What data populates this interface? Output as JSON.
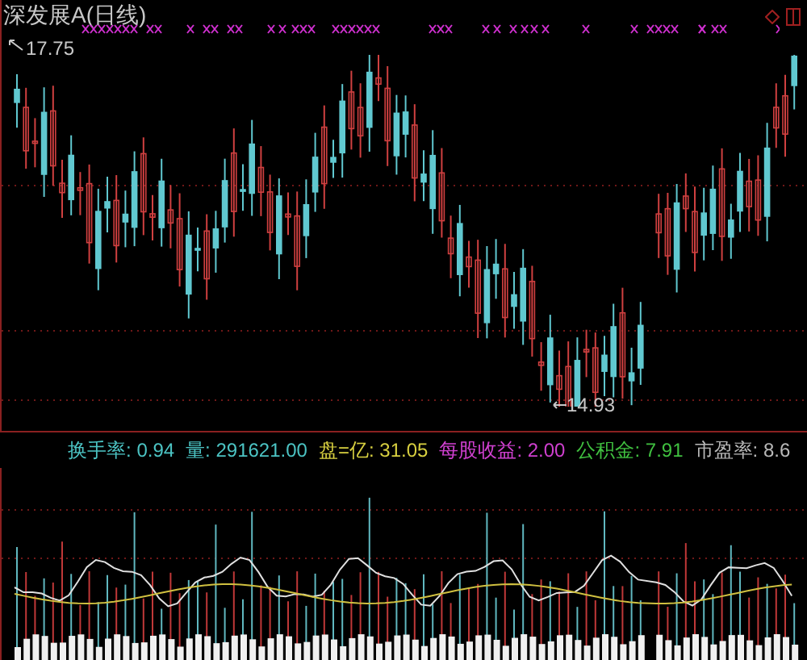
{
  "title": "深发展A(日线)",
  "price_high": "17.75",
  "price_low": "14.93",
  "indicators": [
    {
      "label": "换手率:",
      "value": "0.94",
      "color": "#4cc4c4"
    },
    {
      "label": "量:",
      "value": "291621.00",
      "color": "#4cc4c4"
    },
    {
      "label": "盘=亿:",
      "value": "31.05",
      "color": "#d8d040"
    },
    {
      "label": "每股收益:",
      "value": "2.00",
      "color": "#d040d0"
    },
    {
      "label": "公积金:",
      "value": "7.91",
      "color": "#40c040"
    },
    {
      "label": "市盈率:",
      "value": "8.6",
      "color": "#b8b8b8"
    }
  ]
}
